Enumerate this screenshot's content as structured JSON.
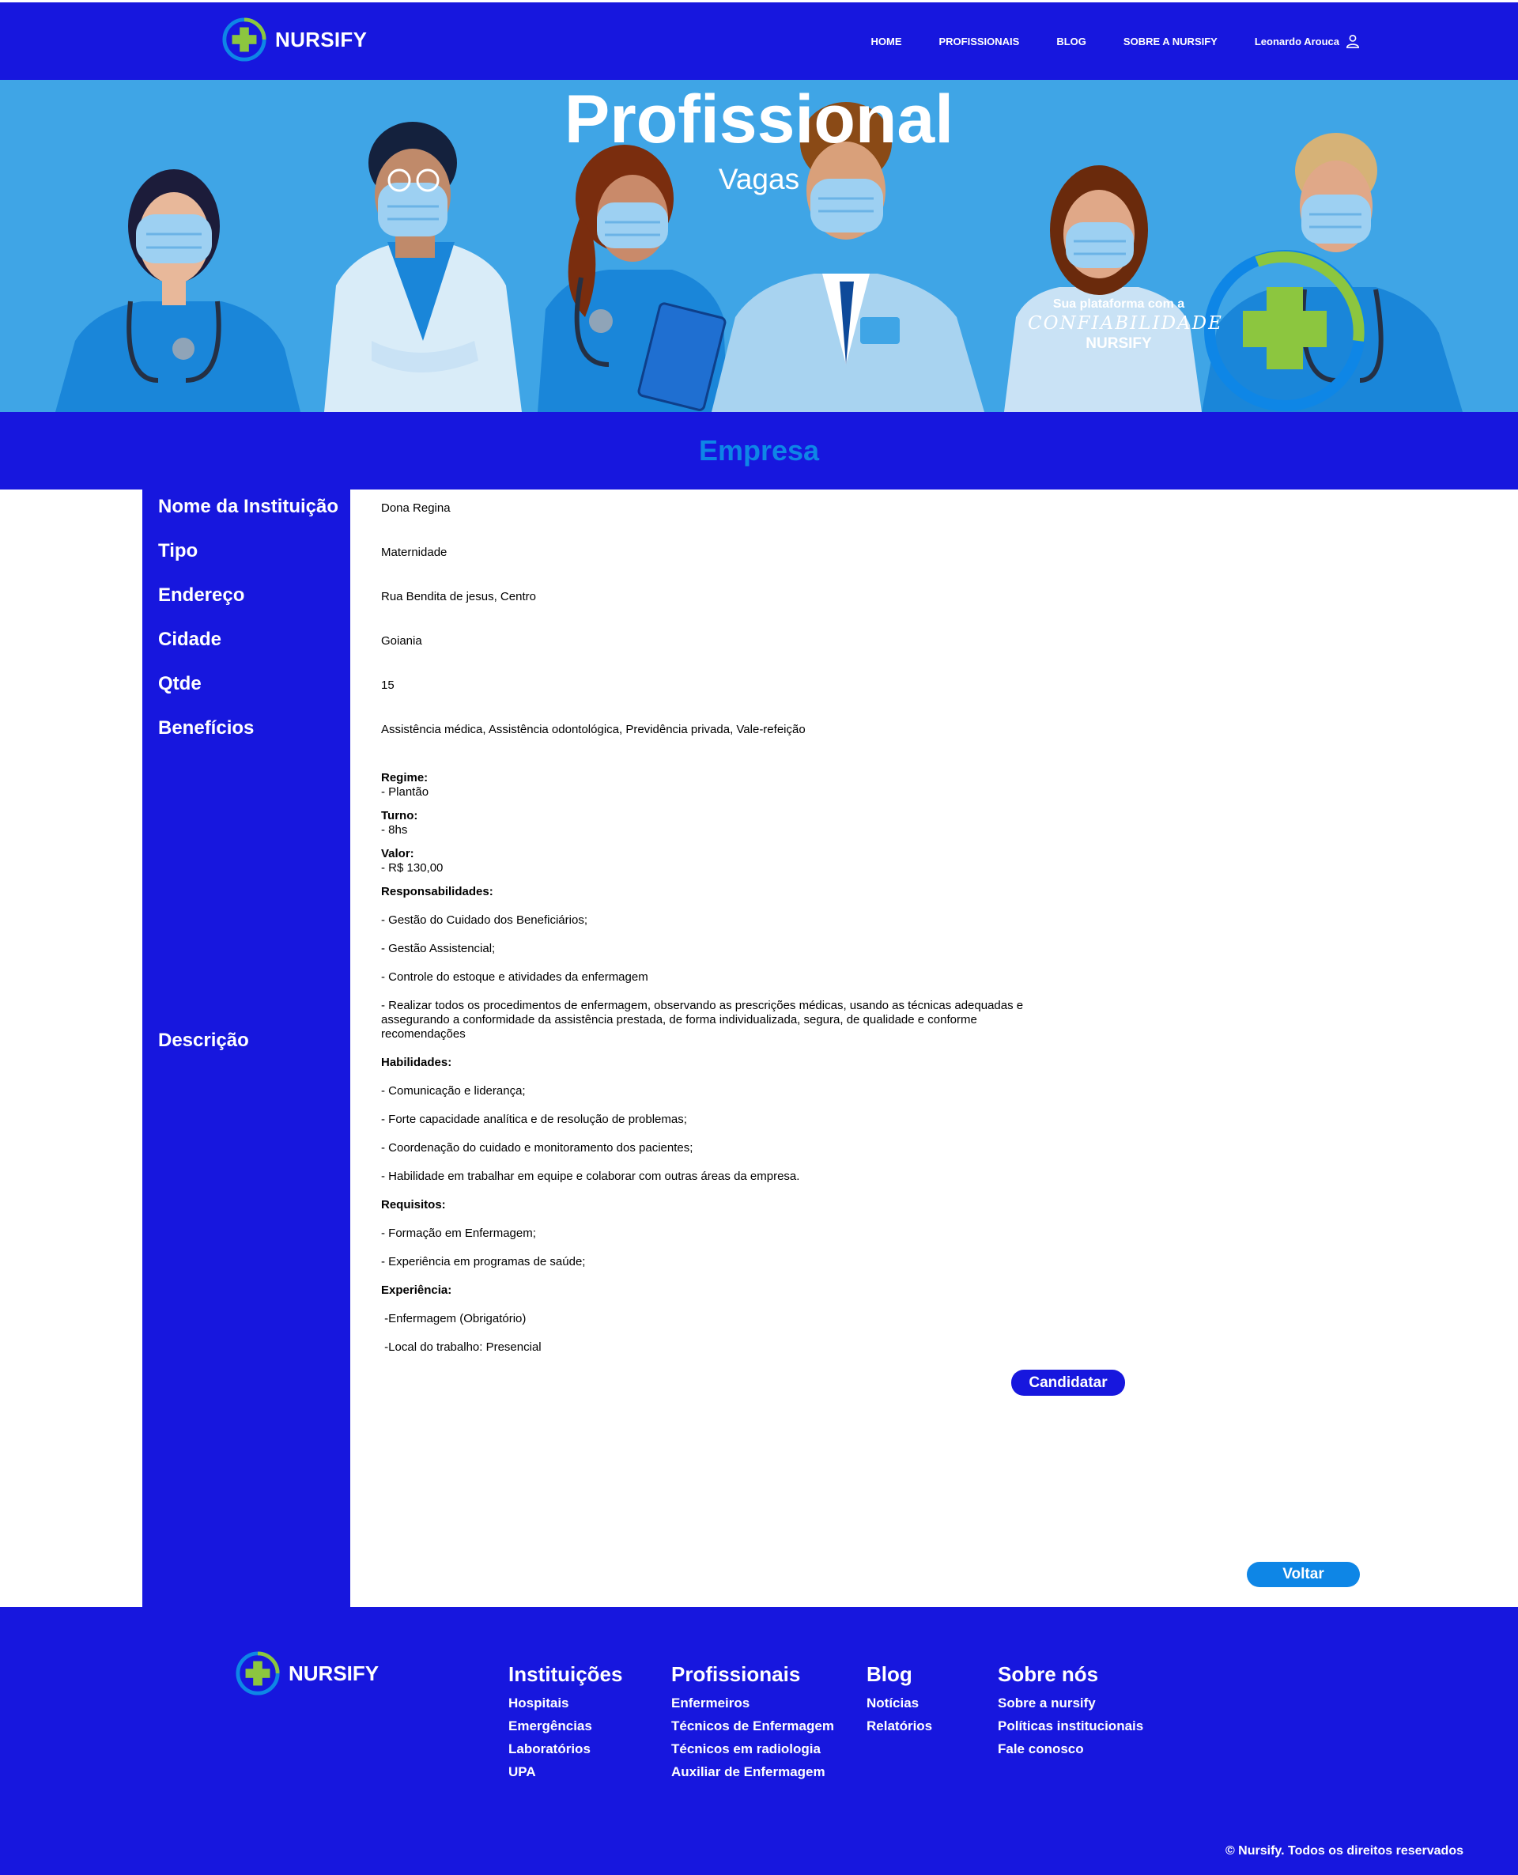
{
  "nav": {
    "brand": "NURSIFY",
    "links": [
      "HOME",
      "PROFISSIONAIS",
      "BLOG",
      "SOBRE A NURSIFY"
    ],
    "user": "Leonardo Arouca"
  },
  "hero": {
    "title": "Profissional",
    "subtitle": "Vagas",
    "badge_line1": "Sua plataforma com a",
    "badge_line2": "CONFIABILIDADE",
    "badge_line3": "NURSIFY"
  },
  "section": {
    "title": "Empresa"
  },
  "fields": {
    "institution_label": "Nome da Instituição",
    "institution_value": "Dona Regina",
    "type_label": "Tipo",
    "type_value": "Maternidade",
    "address_label": "Endereço",
    "address_value": "Rua Bendita  de jesus, Centro",
    "city_label": "Cidade",
    "city_value": "Goiania",
    "qty_label": "Qtde",
    "qty_value": "15",
    "benefits_label": "Benefícios",
    "benefits_value": "Assistência médica, Assistência odontológica, Previdência privada, Vale-refeição",
    "description_label": "Descrição"
  },
  "description": {
    "regime_title": "Regime:",
    "regime_value": "- Plantão",
    "shift_title": "Turno:",
    "shift_value": "- 8hs",
    "pay_title": "Valor:",
    "pay_value": "- R$ 130,00",
    "resp_title": "Responsabilidades:",
    "responsibilities": [
      "- Gestão do Cuidado dos Beneficiários;",
      "- Gestão Assistencial;",
      "- Controle do estoque e atividades da enfermagem",
      "- Realizar todos os procedimentos de enfermagem, observando as prescrições médicas, usando as técnicas adequadas e assegurando a conformidade da assistência prestada, de forma individualizada, segura, de qualidade e conforme recomendações"
    ],
    "skills_title": "Habilidades:",
    "skills": [
      "- Comunicação e liderança;",
      "- Forte capacidade analítica e de resolução de problemas;",
      "- Coordenação do cuidado e monitoramento dos pacientes;",
      "- Habilidade em trabalhar em equipe e colaborar com outras áreas da empresa."
    ],
    "req_title": "Requisitos:",
    "requirements": [
      "- Formação em Enfermagem;",
      "- Experiência em programas de saúde;"
    ],
    "exp_title": "Experiência:",
    "experience": [
      " -Enfermagem (Obrigatório)",
      " -Local do trabalho: Presencial"
    ]
  },
  "buttons": {
    "apply": "Candidatar",
    "back": "Voltar"
  },
  "footer": {
    "brand": "NURSIFY",
    "columns": [
      {
        "title": "Instituições",
        "links": [
          "Hospitais",
          "Emergências",
          "Laboratórios",
          "UPA"
        ]
      },
      {
        "title": "Profissionais",
        "links": [
          "Enfermeiros",
          "Técnicos de Enfermagem",
          "Técnicos em radiologia",
          "Auxiliar de Enfermagem"
        ]
      },
      {
        "title": "Blog",
        "links": [
          "Notícias",
          "Relatórios"
        ]
      },
      {
        "title": "Sobre nós",
        "links": [
          "Sobre a nursify",
          "Políticas institucionais",
          "Fale conosco"
        ]
      }
    ],
    "copyright": "© Nursify. Todos os direitos reservados"
  },
  "colors": {
    "primary": "#1717de",
    "accent": "#0e86e6",
    "hero_bg": "#3fa5e6",
    "logo_green": "#8cc63f"
  }
}
